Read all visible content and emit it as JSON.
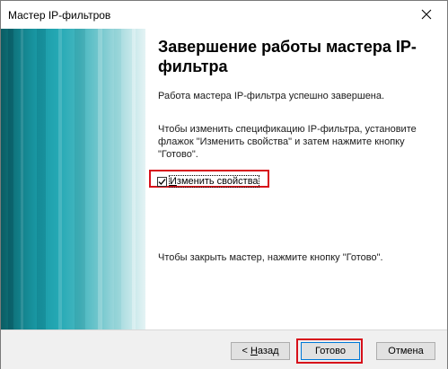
{
  "window": {
    "title": "Мастер IP-фильтров",
    "close_glyph": "✕"
  },
  "content": {
    "heading": "Завершение работы мастера IP-фильтра",
    "completed_text": "Работа мастера IP-фильтра успешно завершена.",
    "instruction_text": "Чтобы изменить спецификацию IP-фильтра, установите флажок \"Изменить свойства\" и затем нажмите кнопку \"Готово\".",
    "checkbox": {
      "label_accel": "И",
      "label_rest": "зменить свойства",
      "checked": true
    },
    "close_hint": "Чтобы закрыть мастер, нажмите кнопку \"Готово\"."
  },
  "footer": {
    "back_prefix": "< ",
    "back_accel": "Н",
    "back_rest": "азад",
    "finish_label": "Готово",
    "cancel_label": "Отмена"
  },
  "colors": {
    "highlight": "#d7101a",
    "banner_dark": "#0b5d63",
    "banner_light": "#e4f3f4",
    "default_button_border": "#0078d7"
  },
  "icons": {
    "close": "close-icon",
    "checkbox_check": "checkmark-icon"
  }
}
